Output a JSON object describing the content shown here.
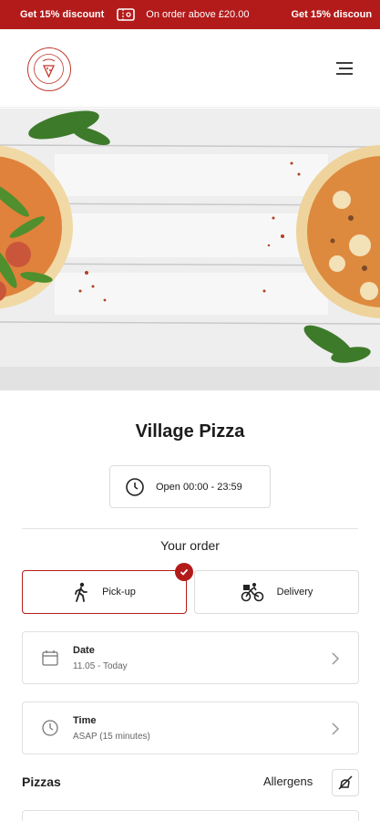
{
  "promo": {
    "text1": "Get 15% discount",
    "text2": "On order above £20.00",
    "text3": "Get 15% discoun"
  },
  "header": {
    "logo_icon": "restaurant-logo-icon",
    "menu_icon": "hamburger-menu-icon"
  },
  "restaurant": {
    "name": "Village Pizza",
    "hours": "Open 00:00 - 23:59"
  },
  "order": {
    "heading": "Your order",
    "modes": [
      {
        "label": "Pick-up",
        "icon": "walking-person-icon",
        "selected": true
      },
      {
        "label": "Delivery",
        "icon": "bicycle-icon",
        "selected": false
      }
    ],
    "date": {
      "label": "Date",
      "value": "11.05 - Today"
    },
    "time": {
      "label": "Time",
      "value": "ASAP (15 minutes)"
    }
  },
  "menu": {
    "section": "Pizzas",
    "allergens_label": "Allergens"
  },
  "colors": {
    "accent": "#b31b1b"
  }
}
